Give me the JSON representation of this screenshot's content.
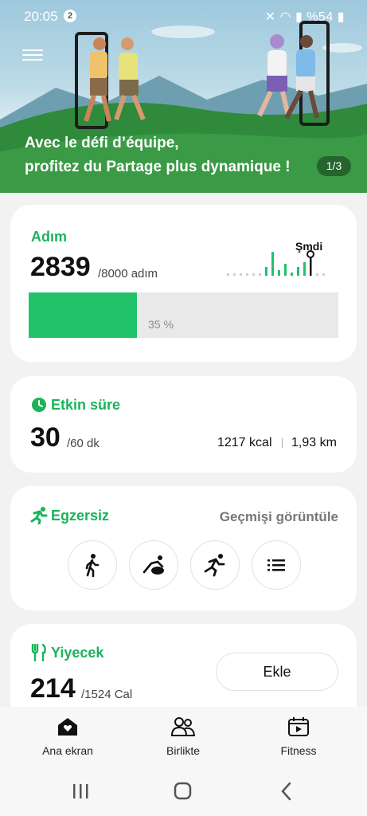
{
  "status_bar": {
    "time": "20:05",
    "notification_count": "2",
    "battery": "%54"
  },
  "banner": {
    "line1": "Avec le défi d’équipe,",
    "line2": "profitez du Partage plus dynamique !",
    "pager": "1/3"
  },
  "steps": {
    "title": "Adım",
    "value": "2839",
    "goal": "/8000 adım",
    "now_label": "Şmdi",
    "progress_label": "35 %",
    "progress_fraction": 0.35,
    "accent": "#21c36a"
  },
  "active_time": {
    "title": "Etkin süre",
    "value": "30",
    "goal": "/60 dk",
    "calories": "1217 kcal",
    "distance": "1,93 km"
  },
  "exercise": {
    "title": "Egzersiz",
    "history_link": "Geçmişi görüntüle",
    "buttons": [
      "walking-icon",
      "yoga-icon",
      "running-icon",
      "list-icon"
    ]
  },
  "food": {
    "title": "Yiyecek",
    "value": "214",
    "goal": "/1524 Cal",
    "add_label": "Ekle"
  },
  "bottom_nav": {
    "home": "Ana ekran",
    "together": "Birlikte",
    "fitness": "Fitness"
  }
}
